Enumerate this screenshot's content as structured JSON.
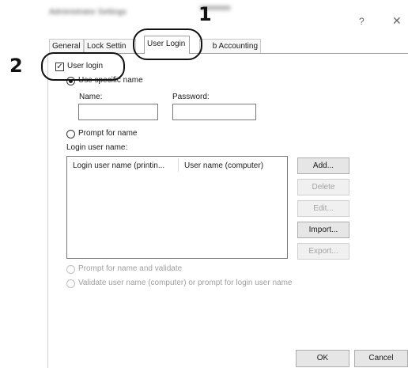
{
  "window": {
    "title": "Administrator Settings",
    "help_glyph": "?",
    "close_glyph": "✕"
  },
  "tabs": [
    {
      "label": "General"
    },
    {
      "label": "Lock Settin"
    },
    {
      "label": "User Login",
      "active": true
    },
    {
      "label": "b Accounting"
    }
  ],
  "callouts": {
    "one": "1",
    "two": "2"
  },
  "user_login": {
    "label": "User login",
    "checked": true,
    "check_glyph": "✓"
  },
  "specific_name": {
    "label": "Use specific name",
    "selected": true
  },
  "name_field": {
    "label": "Name:",
    "value": ""
  },
  "password_field": {
    "label": "Password:",
    "value": ""
  },
  "prompt_for_name": {
    "label": "Prompt for name",
    "selected": false
  },
  "login_list": {
    "label": "Login user name:",
    "columns": [
      "Login user name (printin...",
      "User name (computer)"
    ],
    "rows": []
  },
  "buttons": {
    "add": "Add...",
    "delete": "Delete",
    "edit": "Edit...",
    "import": "Import...",
    "export": "Export..."
  },
  "prompt_validate": {
    "label": "Prompt for name and validate",
    "enabled": false
  },
  "validate_user": {
    "label": "Validate user name (computer) or prompt for login user name",
    "enabled": false
  },
  "footer": {
    "ok": "OK",
    "cancel": "Cancel"
  }
}
